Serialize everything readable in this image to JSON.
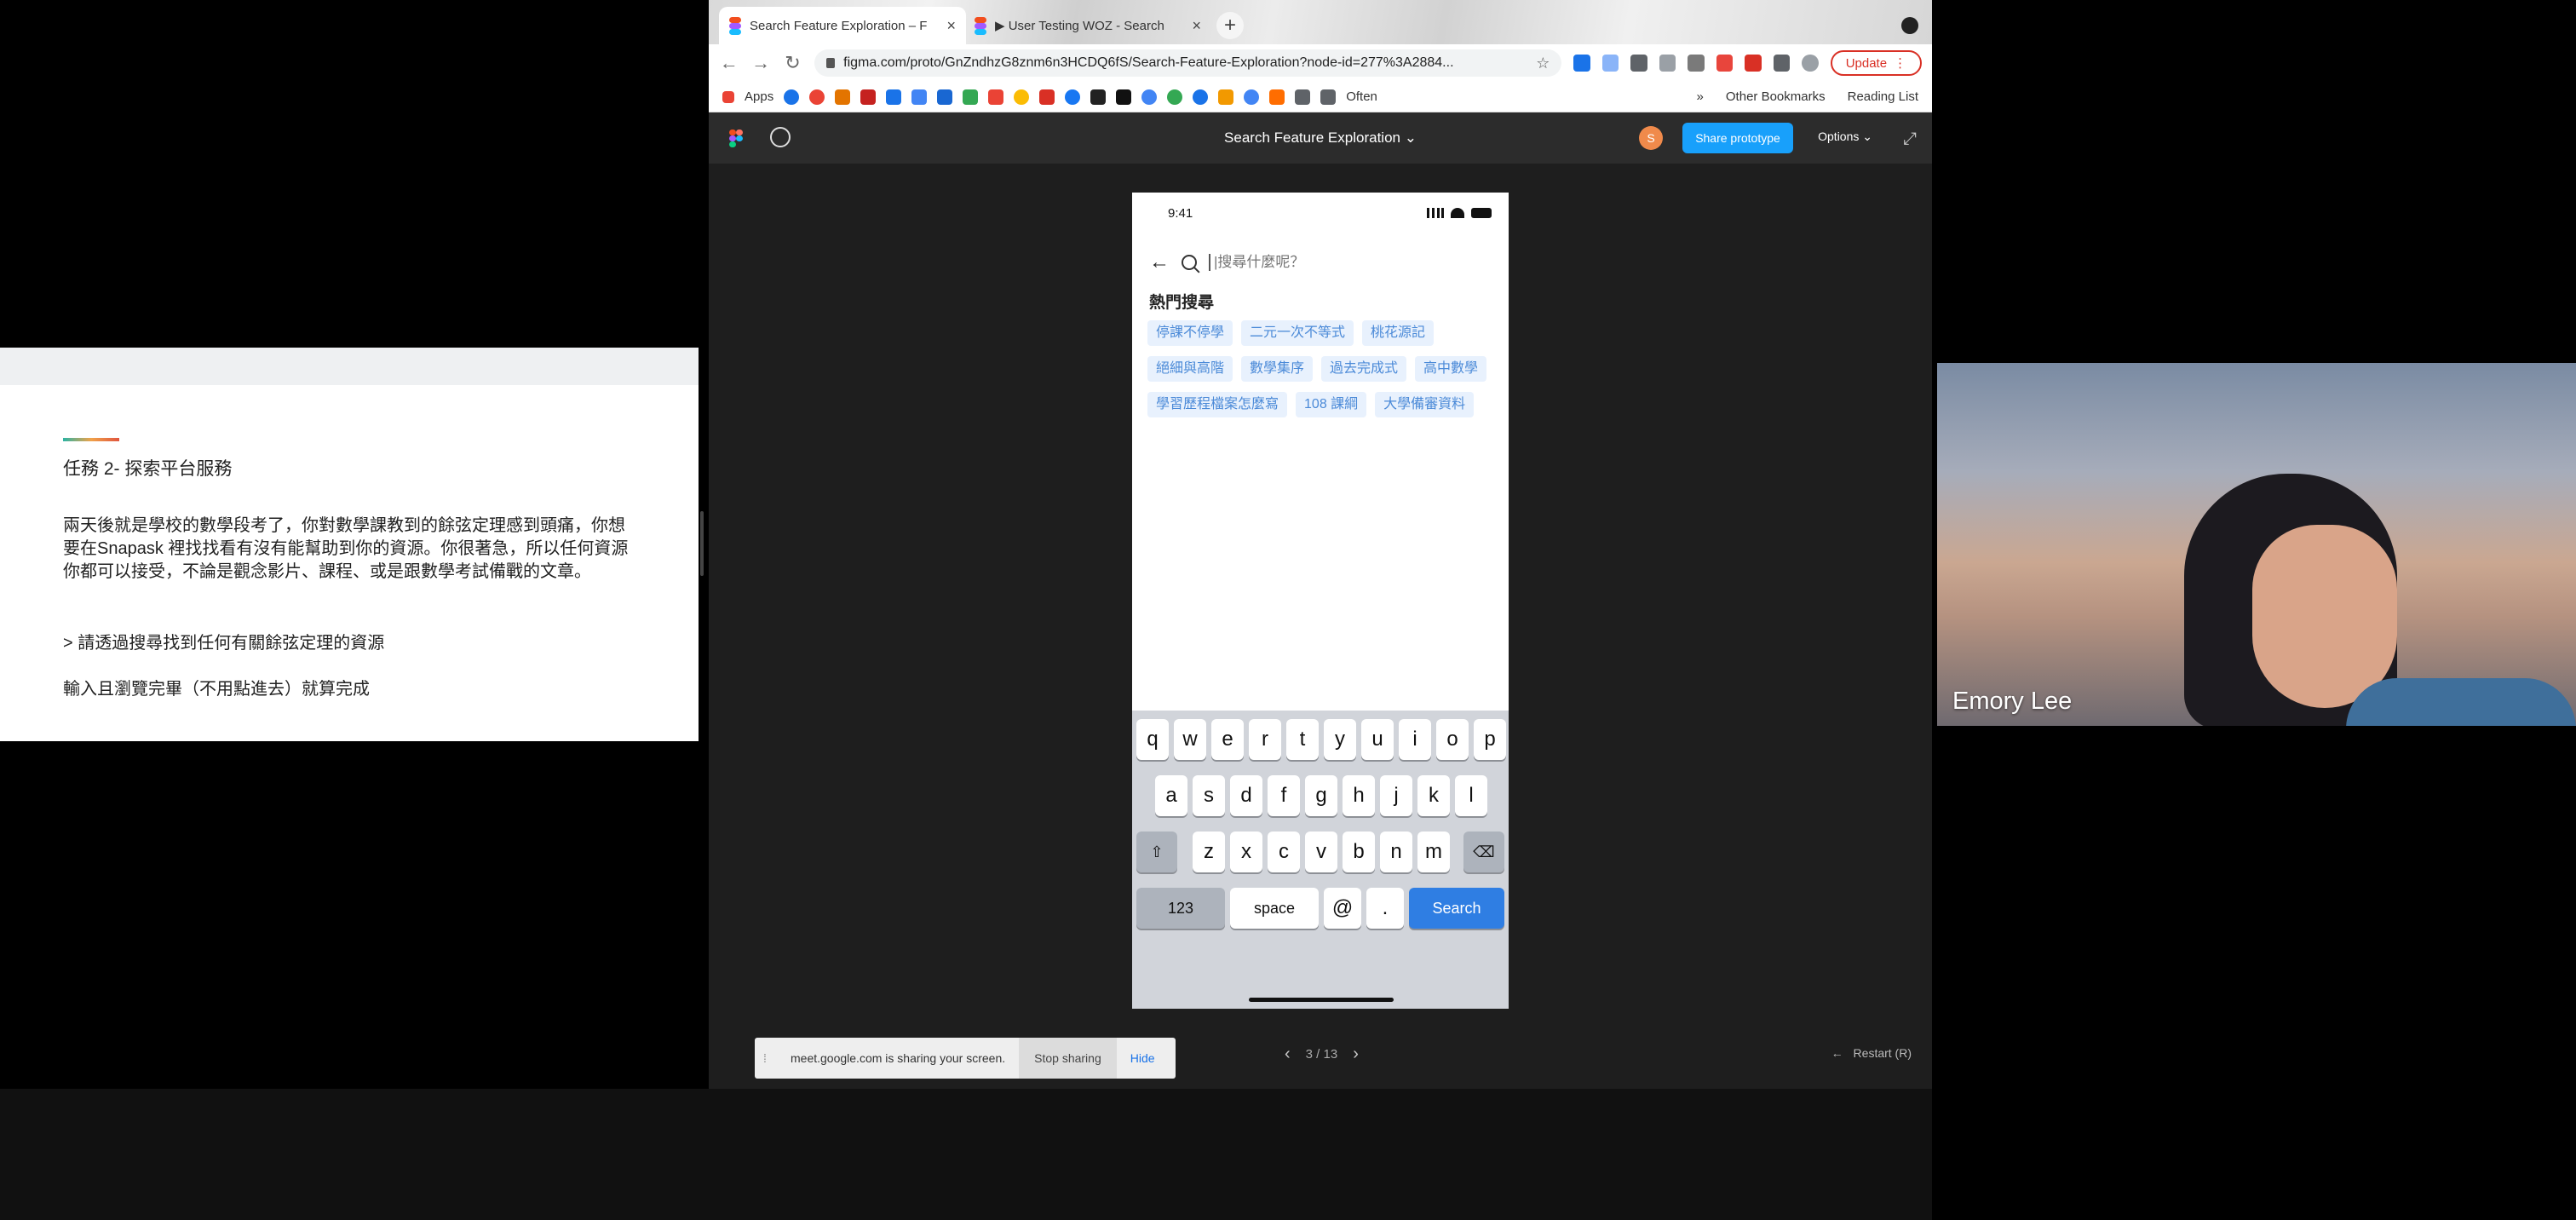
{
  "browser": {
    "tabs": [
      {
        "title": "Search Feature Exploration – F",
        "active": true
      },
      {
        "title": "▶ User Testing WOZ - Search",
        "active": false
      }
    ],
    "url": "figma.com/proto/GnZndhzG8znm6n3HCDQ6fS/Search-Feature-Exploration?node-id=277%3A2884...",
    "update_label": "Update",
    "bookmarks": {
      "apps_label": "Apps",
      "often_label": "Often",
      "other_label": "Other Bookmarks",
      "reading_label": "Reading List"
    }
  },
  "figma": {
    "file_title": "Search Feature Exploration",
    "share_label": "Share prototype",
    "options_label": "Options",
    "avatar_initial": "S",
    "pager": "3 / 13",
    "restart_label": "Restart (R)"
  },
  "phone": {
    "time": "9:41",
    "search_placeholder": "|搜尋什麼呢？",
    "hot_title": "熱門搜尋",
    "chips": [
      "停課不停學",
      "二元一次不等式",
      "桃花源記",
      "絕細與高階",
      "數學集序",
      "過去完成式",
      "高中數學",
      "學習歷程檔案怎麼寫",
      "108 課綱",
      "大學備審資料"
    ],
    "keyboard": {
      "row1": [
        "q",
        "w",
        "e",
        "r",
        "t",
        "y",
        "u",
        "i",
        "o",
        "p"
      ],
      "row2": [
        "a",
        "s",
        "d",
        "f",
        "g",
        "h",
        "j",
        "k",
        "l"
      ],
      "row3": [
        "z",
        "x",
        "c",
        "v",
        "b",
        "n",
        "m"
      ],
      "numbers": "123",
      "space": "space",
      "at": "@",
      "dot": ".",
      "search": "Search"
    }
  },
  "share_notice": {
    "text": "meet.google.com is sharing your screen.",
    "stop_label": "Stop sharing",
    "hide_label": "Hide"
  },
  "slide": {
    "title": "任務 2- 探索平台服務",
    "body": "兩天後就是學校的數學段考了，你對數學課教到的餘弦定理感到頭痛，你想要在Snapask 裡找找看有沒有能幫助到你的資源。你很著急，所以任何資源你都可以接受，不論是觀念影片、課程、或是跟數學考試備戰的文章。",
    "step": "> 請透過搜尋找到任何有關餘弦定理的資源",
    "done": "輸入且瀏覽完畢（不用點進去）就算完成"
  },
  "webcam": {
    "name": "Emory Lee"
  },
  "colors": {
    "figma_blue": "#18a0fb",
    "chip_bg": "#e8f1fd",
    "chip_text": "#4b8ad8",
    "keyboard_search": "#2f7ee3"
  }
}
